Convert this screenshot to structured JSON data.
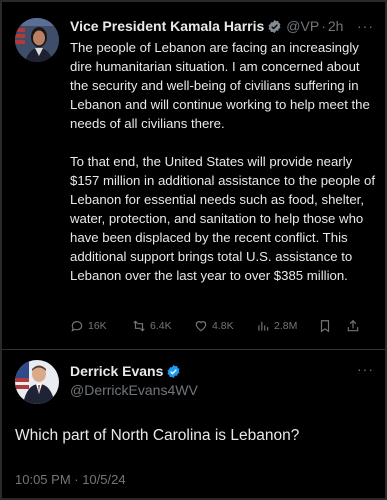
{
  "tweet1": {
    "name": "Vice President Kamala Harris",
    "handle": "@VP",
    "separator": "·",
    "time": "2h",
    "paragraph1": "The people of Lebanon are facing an increasingly dire humanitarian situation. I am concerned about the security and well-being of civilians suffering in Lebanon and will continue working to help meet the needs of all civilians there.",
    "paragraph2": "To that end, the United States will provide nearly $157 million in additional assistance to the people of Lebanon for essential needs such as food, shelter, water, protection, and sanitation to help those who have been displaced by the recent conflict. This additional support brings total U.S. assistance to Lebanon over the last year to over $385 million.",
    "replies": "16K",
    "reposts": "6.4K",
    "likes": "4.8K",
    "views": "2.8M",
    "more": "···"
  },
  "tweet2": {
    "name": "Derrick Evans",
    "handle": "@DerrickEvans4WV",
    "text": "Which part of North Carolina is Lebanon?",
    "timestamp": "10:05 PM · 10/5/24",
    "more": "···"
  },
  "colors": {
    "verified": "#1d9bf0",
    "background": "#000000",
    "muted": "#71767b"
  }
}
